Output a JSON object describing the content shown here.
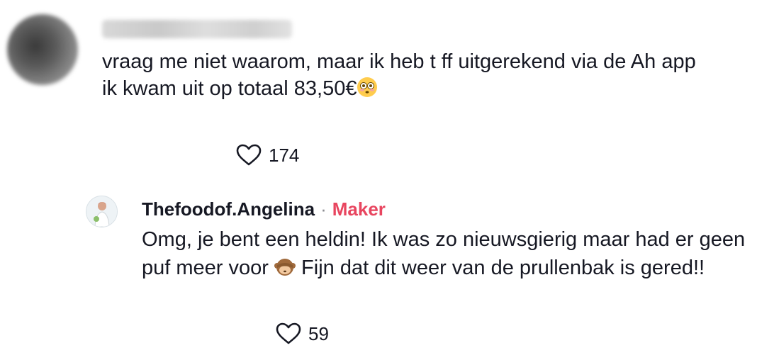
{
  "comment": {
    "text_line1": "vraag me niet waarom, maar ik heb t ff uitgerekend via de Ah app",
    "text_line2": "ik kwam uit op totaal 83,50€",
    "emoji": "flushed-face-emoji",
    "likes": "174"
  },
  "reply": {
    "username": "Thefoodof.Angelina",
    "separator": "·",
    "badge": "Maker",
    "text_part1": "Omg, je bent een heldin! Ik was zo nieuwsgierig maar had er geen puf meer voor ",
    "emoji": "see-no-evil-monkey-emoji",
    "text_part2": " Fijn dat dit weer van de prullenbak is gered!!",
    "likes": "59"
  },
  "colors": {
    "text": "#161823",
    "maker_badge": "#e8455f",
    "separator": "#8a8b91"
  }
}
